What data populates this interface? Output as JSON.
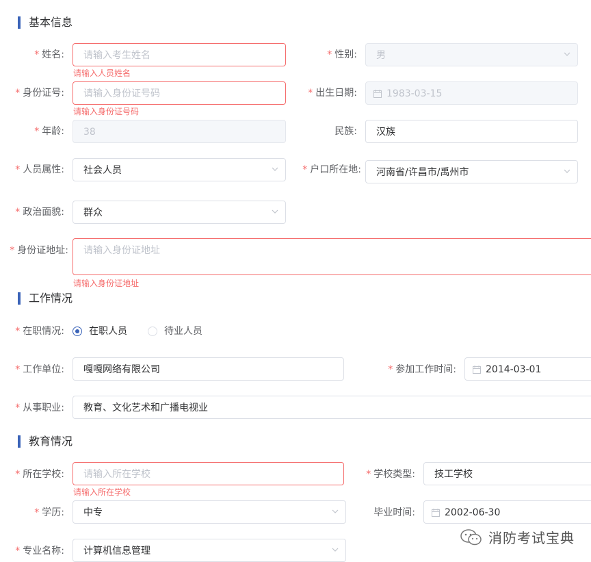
{
  "sections": {
    "basic": "基本信息",
    "work": "工作情况",
    "edu": "教育情况"
  },
  "required_mark": "*",
  "basic": {
    "name": {
      "label": "姓名:",
      "placeholder": "请输入考生姓名",
      "error": "请输入人员姓名"
    },
    "gender": {
      "label": "性别:",
      "value": "男"
    },
    "id_number": {
      "label": "身份证号:",
      "placeholder": "请输入身份证号码",
      "error": "请输入身份证号码"
    },
    "birth_date": {
      "label": "出生日期:",
      "value": "1983-03-15"
    },
    "age": {
      "label": "年龄:",
      "value": "38"
    },
    "ethnicity": {
      "label": "民族:",
      "value": "汉族"
    },
    "person_type": {
      "label": "人员属性:",
      "value": "社会人员"
    },
    "household": {
      "label": "户口所在地:",
      "value": "河南省/许昌市/禹州市"
    },
    "political": {
      "label": "政治面貌:",
      "value": "群众"
    },
    "id_address": {
      "label": "身份证地址:",
      "placeholder": "请输入身份证地址",
      "error": "请输入身份证地址"
    }
  },
  "work": {
    "status": {
      "label": "在职情况:",
      "options": [
        "在职人员",
        "待业人员"
      ],
      "selected": "在职人员"
    },
    "employer": {
      "label": "工作单位:",
      "value": "嘎嘎网络有限公司"
    },
    "start_date": {
      "label": "参加工作时间:",
      "value": "2014-03-01"
    },
    "occupation": {
      "label": "从事职业:",
      "value": "教育、文化艺术和广播电视业"
    }
  },
  "edu": {
    "school": {
      "label": "所在学校:",
      "placeholder": "请输入所在学校",
      "error": "请输入所在学校"
    },
    "school_type": {
      "label": "学校类型:",
      "value": "技工学校"
    },
    "degree": {
      "label": "学历:",
      "value": "中专"
    },
    "grad_date": {
      "label": "毕业时间:",
      "value": "2002-06-30"
    },
    "major": {
      "label": "专业名称:",
      "value": "计算机信息管理"
    }
  },
  "watermark": "消防考试宝典",
  "colors": {
    "accent": "#3a63b8",
    "error": "#f56c6c"
  }
}
